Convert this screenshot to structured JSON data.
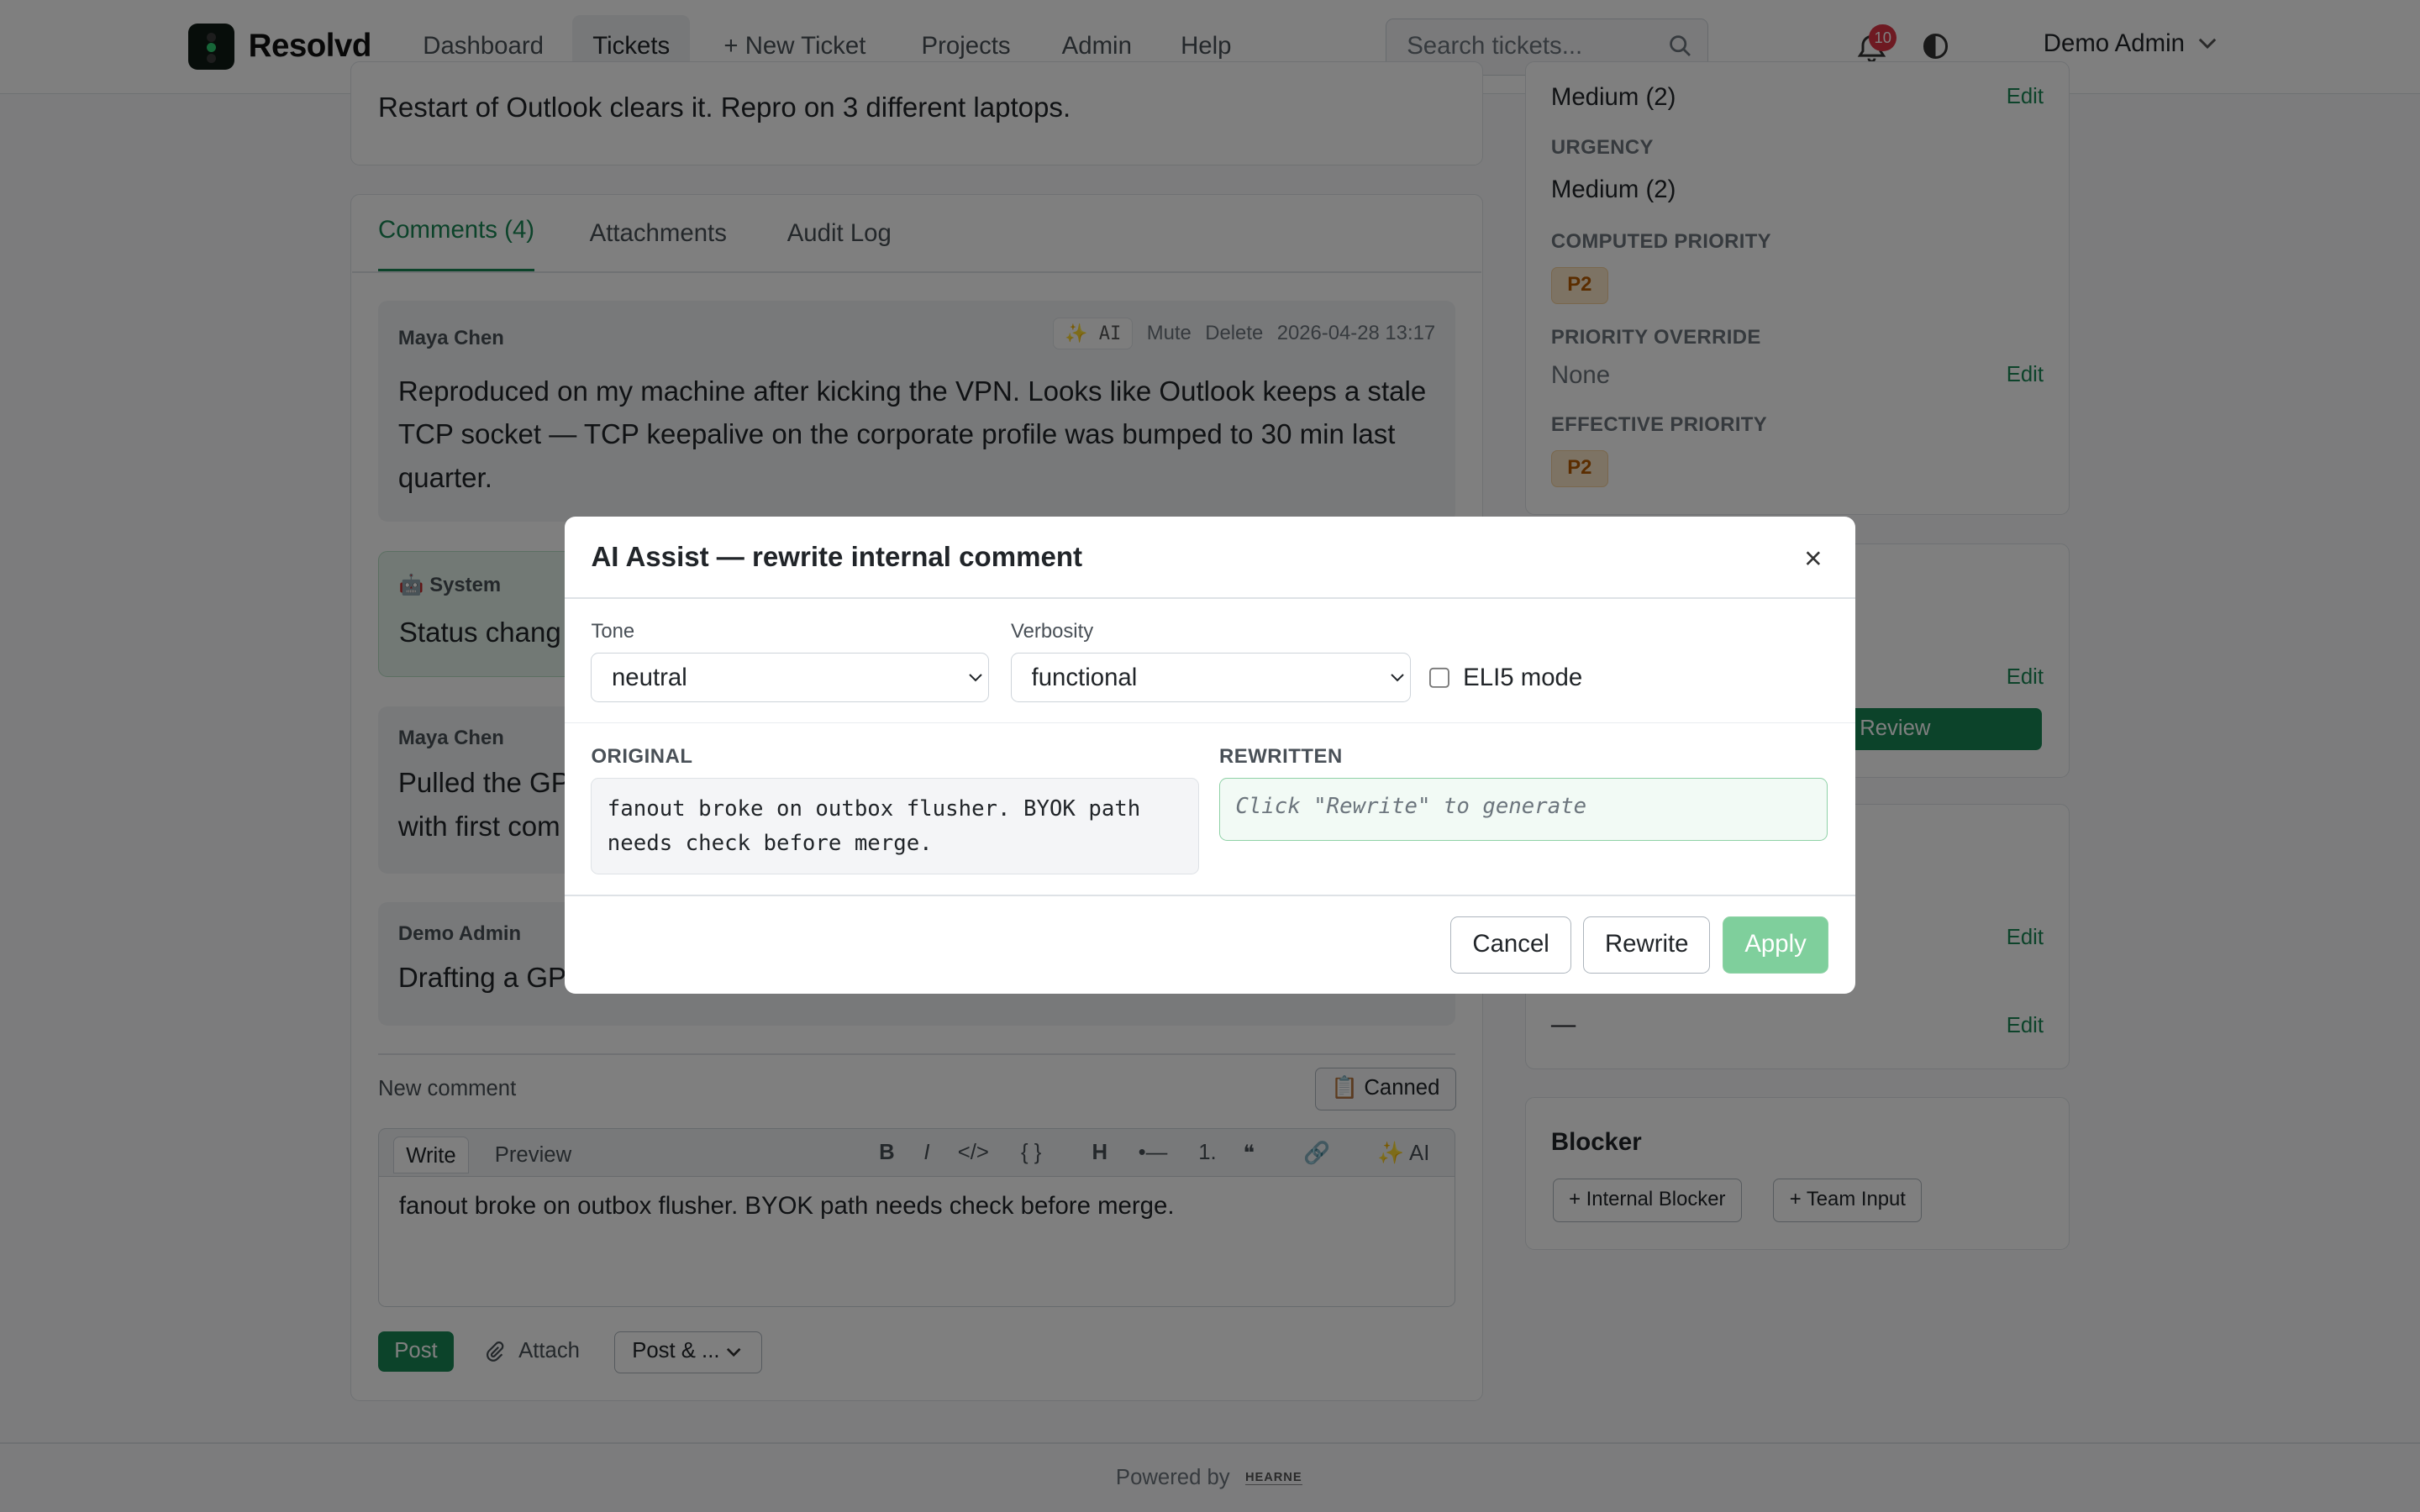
{
  "brand": {
    "name": "Resolvd"
  },
  "nav": {
    "items": [
      {
        "label": "Dashboard"
      },
      {
        "label": "Tickets"
      },
      {
        "label": "+ New Ticket"
      },
      {
        "label": "Projects"
      },
      {
        "label": "Admin"
      },
      {
        "label": "Help"
      }
    ],
    "search_placeholder": "Search tickets...",
    "notification_count": "10",
    "user_name": "Demo Admin"
  },
  "ticket": {
    "description_tail": "Restart of Outlook clears it. Repro on 3 different laptops.",
    "tabs": [
      {
        "label": "Comments (4)"
      },
      {
        "label": "Attachments"
      },
      {
        "label": "Audit Log"
      }
    ],
    "comments": [
      {
        "author": "Maya Chen",
        "ai_label": "✨ AI",
        "mute_label": "Mute",
        "delete_label": "Delete",
        "timestamp": "2026-04-28 13:17",
        "body": "Reproduced on my machine after kicking the VPN. Looks like Outlook keeps a stale TCP socket — TCP keepalive on the corporate profile was bumped to 30 min last quarter."
      },
      {
        "author": "🤖 System",
        "body": "Status chang"
      },
      {
        "author": "Maya Chen",
        "body_line1": "Pulled the GP",
        "body_line2": "with first com"
      },
      {
        "author": "Demo Admin",
        "body": "Drafting a GP"
      }
    ],
    "new_comment": {
      "label": "New comment",
      "canned_label": "📋 Canned",
      "write_tab": "Write",
      "preview_tab": "Preview",
      "tools": [
        "B",
        "I",
        "</>",
        "{ }",
        "H",
        "•—",
        "1.",
        "❝",
        "🔗",
        "✨ AI"
      ],
      "text": "fanout broke on outbox flusher. BYOK path needs check before merge.",
      "post_label": "Post",
      "attach_label": "Attach",
      "post_and_label": "Post & ..."
    }
  },
  "sidebar": {
    "impact_value": "Medium (2)",
    "urgency_label": "URGENCY",
    "urgency_value": "Medium (2)",
    "computed_priority_label": "COMPUTED PRIORITY",
    "computed_priority": "P2",
    "priority_override_label": "PRIORITY OVERRIDE",
    "priority_override_value": "None",
    "effective_priority_label": "EFFECTIVE PRIORITY",
    "effective_priority": "P2",
    "edit_label": "Edit",
    "review_label": "Review",
    "dash_value": "—",
    "blocker_title": "Blocker",
    "internal_blocker_label": "+ Internal Blocker",
    "team_input_label": "+ Team Input"
  },
  "footer": {
    "powered_by": "Powered by",
    "logo_text": "HEARNE"
  },
  "modal": {
    "title": "AI Assist — rewrite internal comment",
    "close_label": "×",
    "tone_label": "Tone",
    "tone_value": "neutral",
    "verbosity_label": "Verbosity",
    "verbosity_value": "functional",
    "eli5_label": "ELI5 mode",
    "original_label": "ORIGINAL",
    "original_text": "fanout broke on outbox flusher. BYOK path needs check before merge.",
    "rewritten_label": "REWRITTEN",
    "rewritten_placeholder": "Click \"Rewrite\" to generate",
    "cancel_label": "Cancel",
    "rewrite_label": "Rewrite",
    "apply_label": "Apply"
  },
  "colors": {
    "accent": "#198754",
    "priority_badge": "#fbe7c9",
    "danger": "#dc3545"
  }
}
